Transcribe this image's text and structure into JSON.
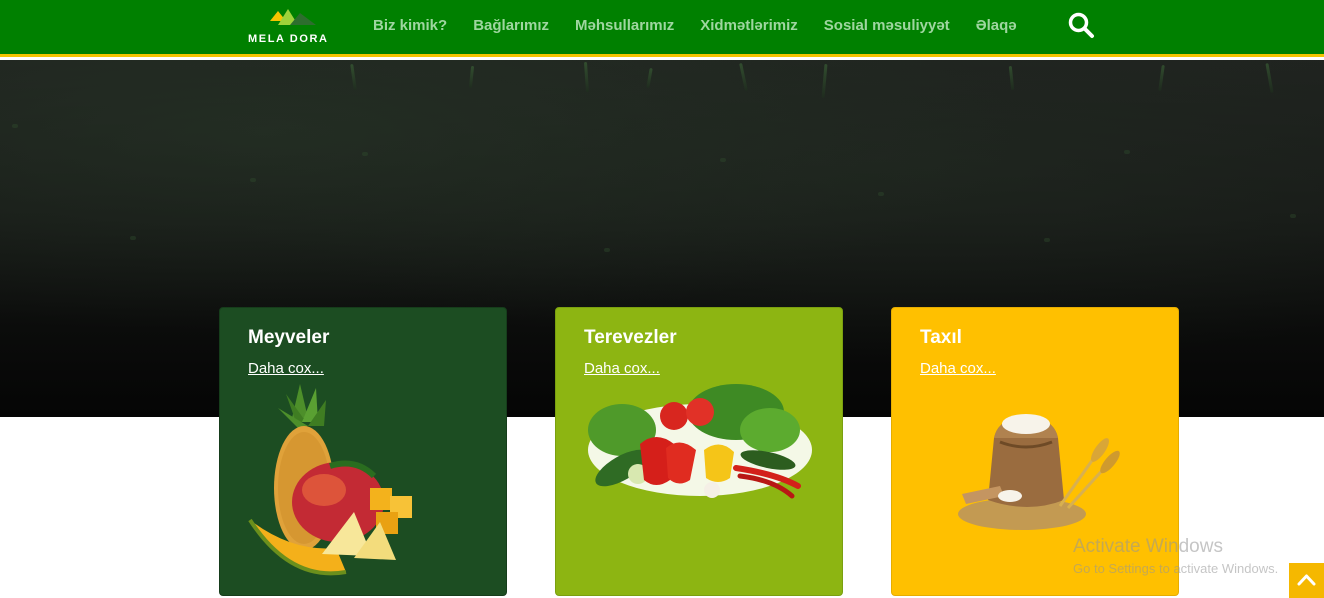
{
  "brand": {
    "name": "MELA DORA"
  },
  "nav": {
    "items": [
      {
        "label": "Biz kimik?"
      },
      {
        "label": "Bağlarımız"
      },
      {
        "label": "Məhsullarımız"
      },
      {
        "label": "Xidmətlərimiz"
      },
      {
        "label": "Sosial məsuliyyət"
      },
      {
        "label": "Əlaqə"
      }
    ],
    "search_icon": "search-icon"
  },
  "cards": [
    {
      "title": "Meyveler",
      "link": "Daha cox...",
      "color": "#1c4d22",
      "image": "fruits"
    },
    {
      "title": "Terevezler",
      "link": "Daha cox...",
      "color": "#8db512",
      "image": "vegetables"
    },
    {
      "title": "Taxıl",
      "link": "Daha cox...",
      "color": "#ffc000",
      "image": "grain"
    }
  ],
  "watermark": {
    "title": "Activate Windows",
    "subtitle": "Go to Settings to activate Windows."
  },
  "colors": {
    "header": "#008000",
    "accent": "#f5c400"
  }
}
